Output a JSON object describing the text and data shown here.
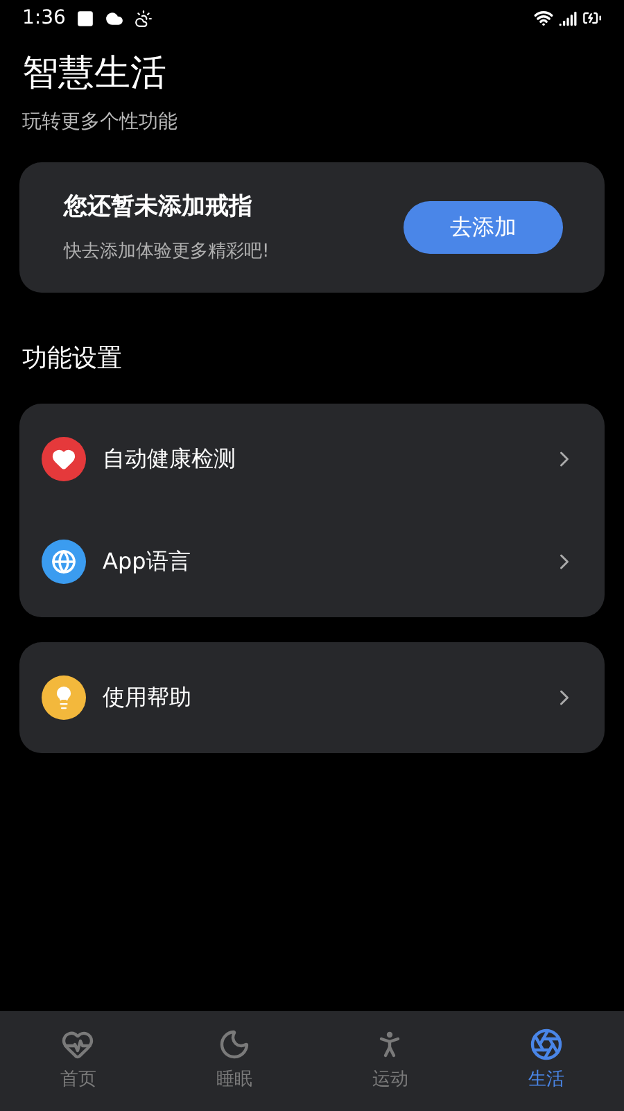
{
  "status_bar": {
    "time": "1:36"
  },
  "header": {
    "title": "智慧生活",
    "subtitle": "玩转更多个性功能"
  },
  "ring_card": {
    "title": "您还暂未添加戒指",
    "subtitle": "快去添加体验更多精彩吧!",
    "button": "去添加"
  },
  "section_title": "功能设置",
  "groups": [
    {
      "items": [
        {
          "label": "自动健康检测",
          "kind": "heart",
          "color": "#e5393b"
        },
        {
          "label": "App语言",
          "kind": "globe",
          "color": "#3b9cf0"
        }
      ]
    },
    {
      "items": [
        {
          "label": "使用帮助",
          "kind": "bulb",
          "color": "#f3b83c"
        }
      ]
    }
  ],
  "nav": [
    {
      "label": "首页",
      "kind": "heart",
      "selected": false
    },
    {
      "label": "睡眠",
      "kind": "moon",
      "selected": false
    },
    {
      "label": "运动",
      "kind": "run",
      "selected": false
    },
    {
      "label": "生活",
      "kind": "aperture",
      "selected": true
    }
  ]
}
